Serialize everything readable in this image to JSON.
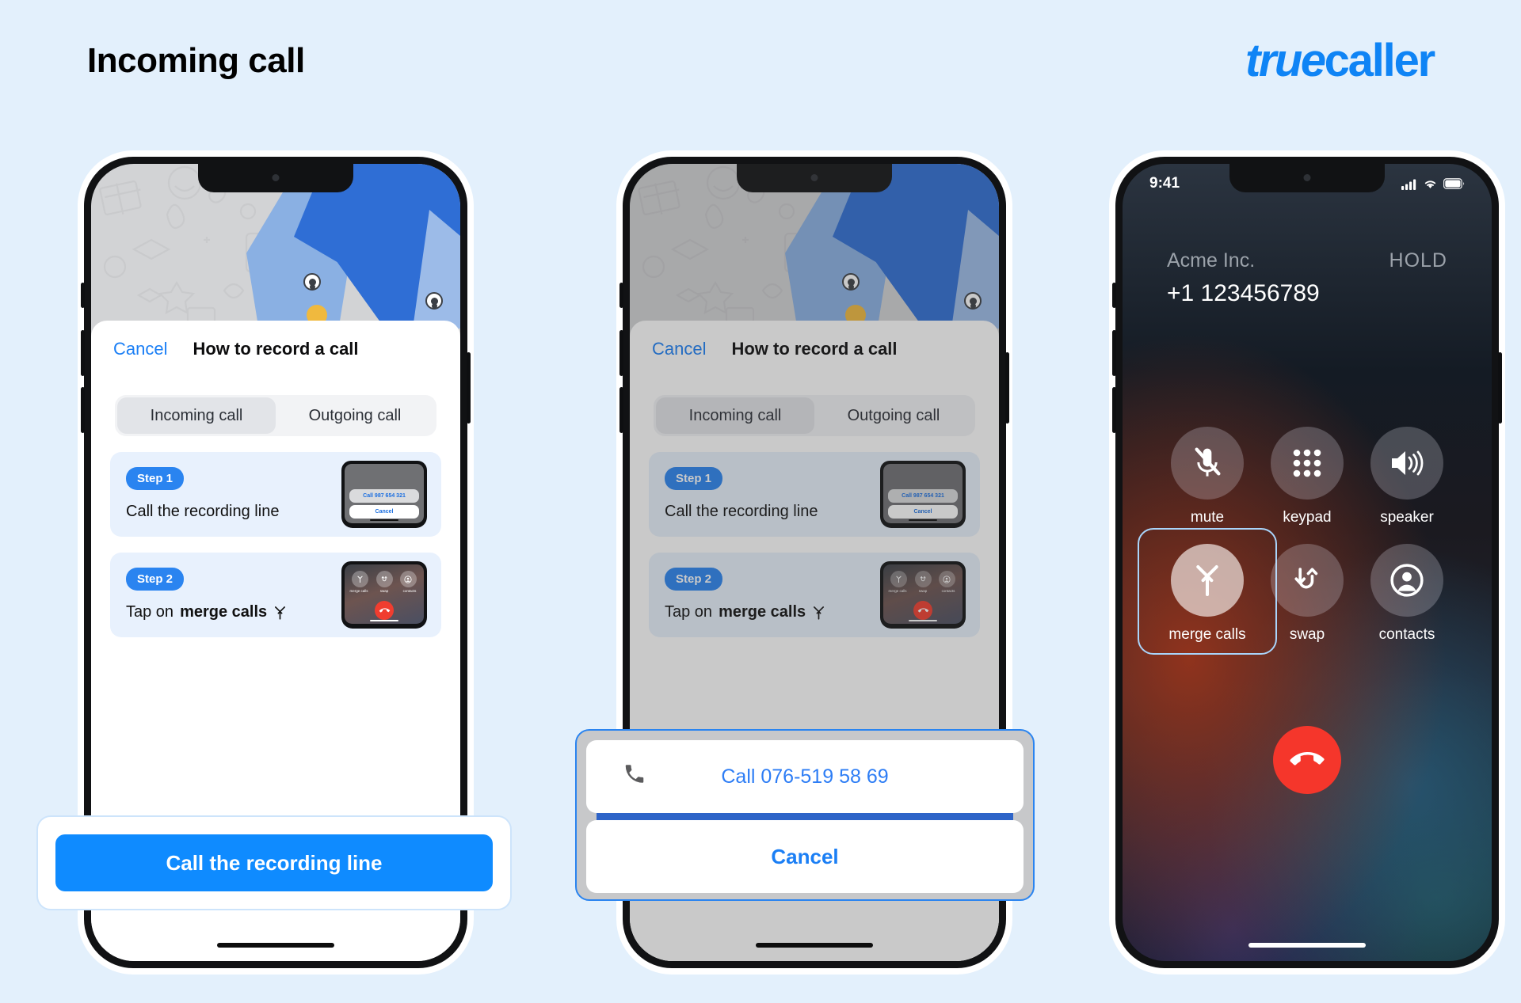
{
  "header": {
    "title": "Incoming call",
    "brand_prefix": "true",
    "brand_suffix": "caller",
    "brand_color": "#0f84f5"
  },
  "sheet": {
    "cancel_label": "Cancel",
    "title": "How to record a call",
    "tabs": [
      {
        "label": "Incoming call",
        "active": true
      },
      {
        "label": "Outgoing call",
        "active": false
      }
    ],
    "steps": [
      {
        "badge": "Step 1",
        "text_prefix": "Call the recording line",
        "text_bold": "",
        "text_suffix": "",
        "thumb": {
          "type": "dialog",
          "call_label": "Call 987 654 321",
          "cancel_label": "Cancel"
        }
      },
      {
        "badge": "Step 2",
        "text_prefix": "Tap on ",
        "text_bold": "merge calls",
        "text_suffix": "",
        "thumb": {
          "type": "incall",
          "labels": [
            "merge calls",
            "swap",
            "contacts"
          ]
        }
      }
    ],
    "cta_label": "Call the recording line"
  },
  "action_sheet": {
    "call_label": "Call 076-519 58 69",
    "cancel_label": "Cancel",
    "border_color": "#2a84f0"
  },
  "incall": {
    "status_time": "9:41",
    "caller_name": "Acme Inc.",
    "call_state": "HOLD",
    "phone_number": "+1 123456789",
    "controls": [
      {
        "label": "mute",
        "icon": "mic-off-icon",
        "highlight": false
      },
      {
        "label": "keypad",
        "icon": "keypad-icon",
        "highlight": false
      },
      {
        "label": "speaker",
        "icon": "speaker-icon",
        "highlight": false
      },
      {
        "label": "merge calls",
        "icon": "merge-calls-icon",
        "highlight": true
      },
      {
        "label": "swap",
        "icon": "swap-icon",
        "highlight": false
      },
      {
        "label": "contacts",
        "icon": "contacts-icon",
        "highlight": false
      }
    ],
    "end_call_icon": "end-call-icon",
    "highlight_color": "#a9d5fb"
  }
}
